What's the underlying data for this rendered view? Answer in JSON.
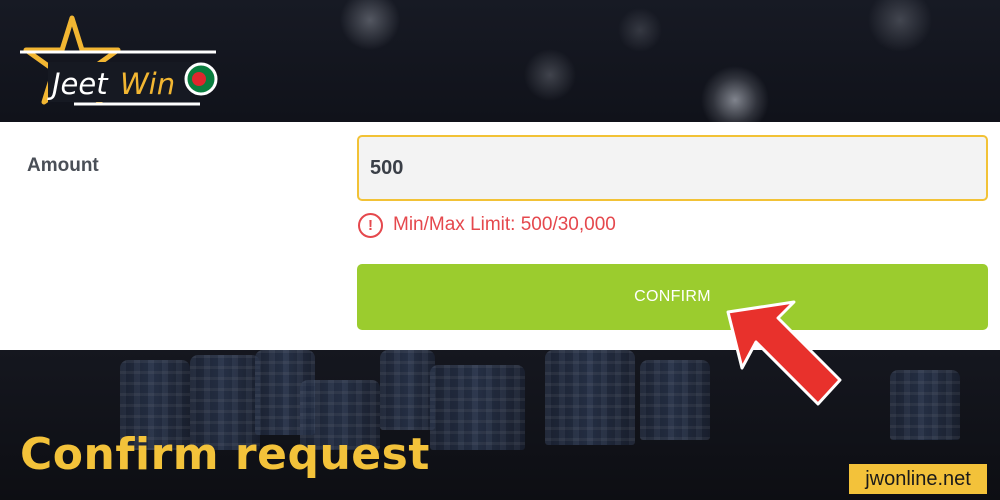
{
  "brand": {
    "logo_text": "JeetWin"
  },
  "form": {
    "amount_label": "Amount",
    "amount_value": "500",
    "limit_text": "Min/Max Limit: 500/30,000",
    "warning_glyph": "!",
    "confirm_label": "CONFIRM"
  },
  "caption": "Confirm request",
  "watermark": "jwonline.net",
  "colors": {
    "accent_yellow": "#f3c23a",
    "confirm_green": "#9bcc2e",
    "error_red": "#e5484d",
    "arrow_red": "#e8312c"
  }
}
